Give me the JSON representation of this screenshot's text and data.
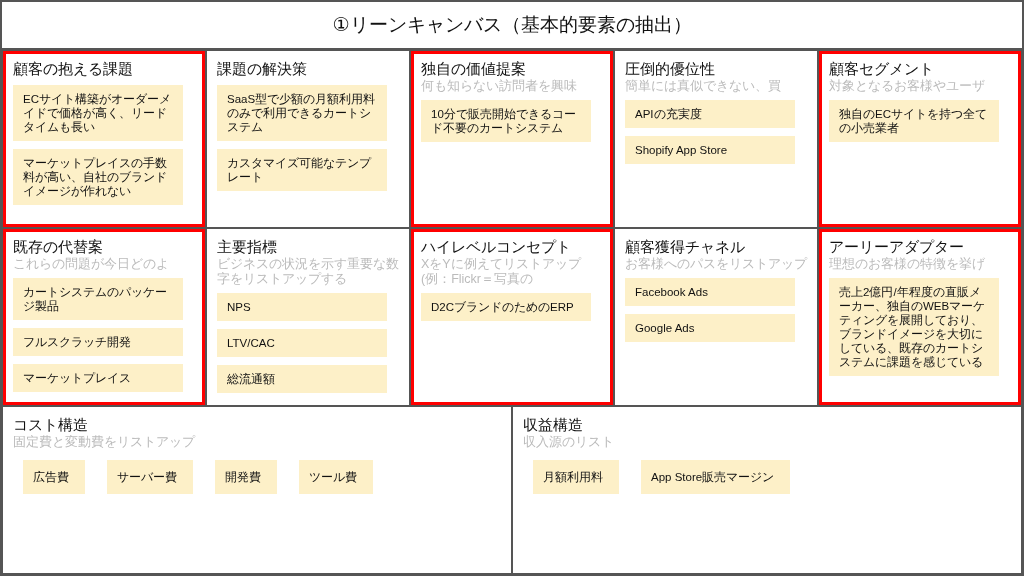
{
  "title": "①リーンキャンバス（基本的要素の抽出）",
  "blocks": [
    {
      "heading": "顧客の抱える課題",
      "highlighted": true,
      "notes": [
        "ECサイト構築がオーダーメイドで価格が高く、リードタイムも長い",
        "マーケットプレイスの手数料が高い、自社のブランドイメージが作れない"
      ]
    },
    {
      "heading": "課題の解決策",
      "highlighted": false,
      "notes": [
        "SaaS型で少額の月額利用料のみで利用できるカートシステム",
        "カスタマイズ可能なテンプレート"
      ]
    },
    {
      "heading": "独自の価値提案",
      "highlighted": true,
      "hint": "何も知らない訪問者を興味",
      "notes": [
        "10分で販売開始できるコード不要のカートシステム"
      ]
    },
    {
      "heading": "圧倒的優位性",
      "highlighted": false,
      "hint": "簡単には真似できない、買",
      "notes": [
        "APIの充実度",
        "Shopify App Store"
      ]
    },
    {
      "heading": "顧客セグメント",
      "highlighted": true,
      "hint": "対象となるお客様やユーザ",
      "notes": [
        "独自のECサイトを持つ全ての小売業者"
      ]
    },
    {
      "heading": "既存の代替案",
      "highlighted": true,
      "hint": "これらの問題が今日どのよ",
      "notes": [
        "カートシステムのパッケージ製品",
        "フルスクラッチ開発",
        "マーケットプレイス"
      ]
    },
    {
      "heading": "主要指標",
      "highlighted": false,
      "hint": "ビジネスの状況を示す重要な数字をリストアップする",
      "notes": [
        "NPS",
        "LTV/CAC",
        "総流通額"
      ]
    },
    {
      "heading": "ハイレベルコンセプト",
      "highlighted": true,
      "hint": "XをYに例えてリストアップ(例：Flickr＝写真の",
      "notes": [
        "D2CブランドのためのERP"
      ]
    },
    {
      "heading": "顧客獲得チャネル",
      "highlighted": false,
      "hint": "お客様へのパスをリストアップ",
      "notes": [
        "Facebook Ads",
        "Google Ads"
      ]
    },
    {
      "heading": "アーリーアダプター",
      "highlighted": true,
      "hint": "理想のお客様の特徴を挙げ",
      "notes": [
        "売上2億円/年程度の直販メーカー、独自のWEBマーケティングを展開しており、ブランドイメージを大切にしている、既存のカートシステムに課題を感じている"
      ]
    }
  ],
  "bottom_blocks": [
    {
      "heading": "コスト構造",
      "hint": "固定費と変動費をリストアップ",
      "notes": [
        "広告費",
        "サーバー費",
        "開発費",
        "ツール費"
      ]
    },
    {
      "heading": "収益構造",
      "hint": "収入源のリスト",
      "notes": [
        "月額利用料",
        "App Store販売マージン"
      ]
    }
  ]
}
